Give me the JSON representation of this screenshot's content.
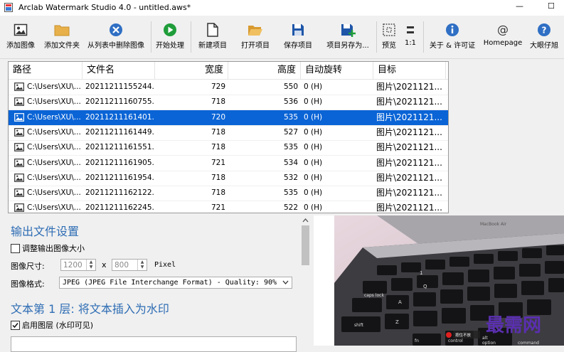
{
  "window": {
    "title": "Arclab Watermark Studio 4.0 - untitled.aws*",
    "min_glyph": "—",
    "max_glyph": "☐"
  },
  "toolbar": [
    {
      "name": "add-image-button",
      "icon": "image-icon",
      "label": "添加图像"
    },
    {
      "name": "add-folder-button",
      "icon": "folder-icon",
      "label": "添加文件夹"
    },
    {
      "name": "remove-image-button",
      "icon": "remove-circle-icon",
      "label": "从列表中删除图像"
    },
    {
      "name": "start-process-button",
      "icon": "play-icon",
      "label": "开始处理"
    },
    {
      "name": "new-project-button",
      "icon": "new-document-icon",
      "label": "新建项目"
    },
    {
      "name": "open-project-button",
      "icon": "open-folder-icon",
      "label": "打开项目"
    },
    {
      "name": "save-project-button",
      "icon": "save-icon",
      "label": "保存项目"
    },
    {
      "name": "save-project-as-button",
      "icon": "save-as-icon",
      "label": "项目另存为..."
    },
    {
      "name": "preview-button",
      "icon": "preview-icon",
      "label": "预览"
    },
    {
      "name": "one-to-one-button",
      "icon": "one-to-one-icon",
      "label": "1:1"
    },
    {
      "name": "about-license-button",
      "icon": "info-icon",
      "label": "关于 & 许可证"
    },
    {
      "name": "homepage-button",
      "icon": "at-icon",
      "label": "Homepage"
    },
    {
      "name": "help-button",
      "icon": "help-icon",
      "label": "大眼仔旭"
    }
  ],
  "table": {
    "columns": [
      "路径",
      "文件名",
      "宽度",
      "高度",
      "自动旋转",
      "目标"
    ],
    "rows": [
      [
        "C:\\Users\\XU\\...",
        "20211211155244...",
        "729",
        "550",
        "0 (H)",
        "图片\\2021121..."
      ],
      [
        "C:\\Users\\XU\\...",
        "20211211160755...",
        "718",
        "536",
        "0 (H)",
        "图片\\2021121..."
      ],
      [
        "C:\\Users\\XU\\...",
        "20211211161401...",
        "720",
        "535",
        "0 (H)",
        "图片\\2021121..."
      ],
      [
        "C:\\Users\\XU\\...",
        "20211211161449...",
        "718",
        "527",
        "0 (H)",
        "图片\\2021121..."
      ],
      [
        "C:\\Users\\XU\\...",
        "20211211161551...",
        "718",
        "535",
        "0 (H)",
        "图片\\2021121..."
      ],
      [
        "C:\\Users\\XU\\...",
        "20211211161905...",
        "721",
        "534",
        "0 (H)",
        "图片\\2021121..."
      ],
      [
        "C:\\Users\\XU\\...",
        "20211211161954...",
        "718",
        "532",
        "0 (H)",
        "图片\\2021121..."
      ],
      [
        "C:\\Users\\XU\\...",
        "20211211162122...",
        "718",
        "535",
        "0 (H)",
        "图片\\2021121..."
      ],
      [
        "C:\\Users\\XU\\...",
        "20211211162245...",
        "721",
        "522",
        "0 (H)",
        "图片\\2021121..."
      ]
    ],
    "selected_row": 2
  },
  "settings": {
    "output_title": "输出文件设置",
    "resize_label": "调整输出图像大小",
    "resize_checked": false,
    "size_label": "图像尺寸:",
    "width_value": "1200",
    "x_sep": "x",
    "height_value": "800",
    "unit": "Pixel",
    "format_label": "图像格式:",
    "format_value": "JPEG (JPEG File Interchange Format) - Quality: 90%",
    "layer_title": "文本第 1 层: 将文本插入为水印",
    "enable_layer_label": "启用图层 (水印可见)",
    "enable_layer_checked": true
  },
  "preview": {
    "laptop_brand": "MacBook Air",
    "keys": [
      "caps lock",
      "shift",
      "fn",
      "control",
      "option",
      "command",
      "alt",
      "1",
      "Q",
      "A",
      "Z"
    ],
    "overlay_badge": "按住不放",
    "watermark": "最需网"
  },
  "colors": {
    "accent": "#2e6db4",
    "selection": "#0a64d6",
    "watermark": "#5a2fb0"
  }
}
